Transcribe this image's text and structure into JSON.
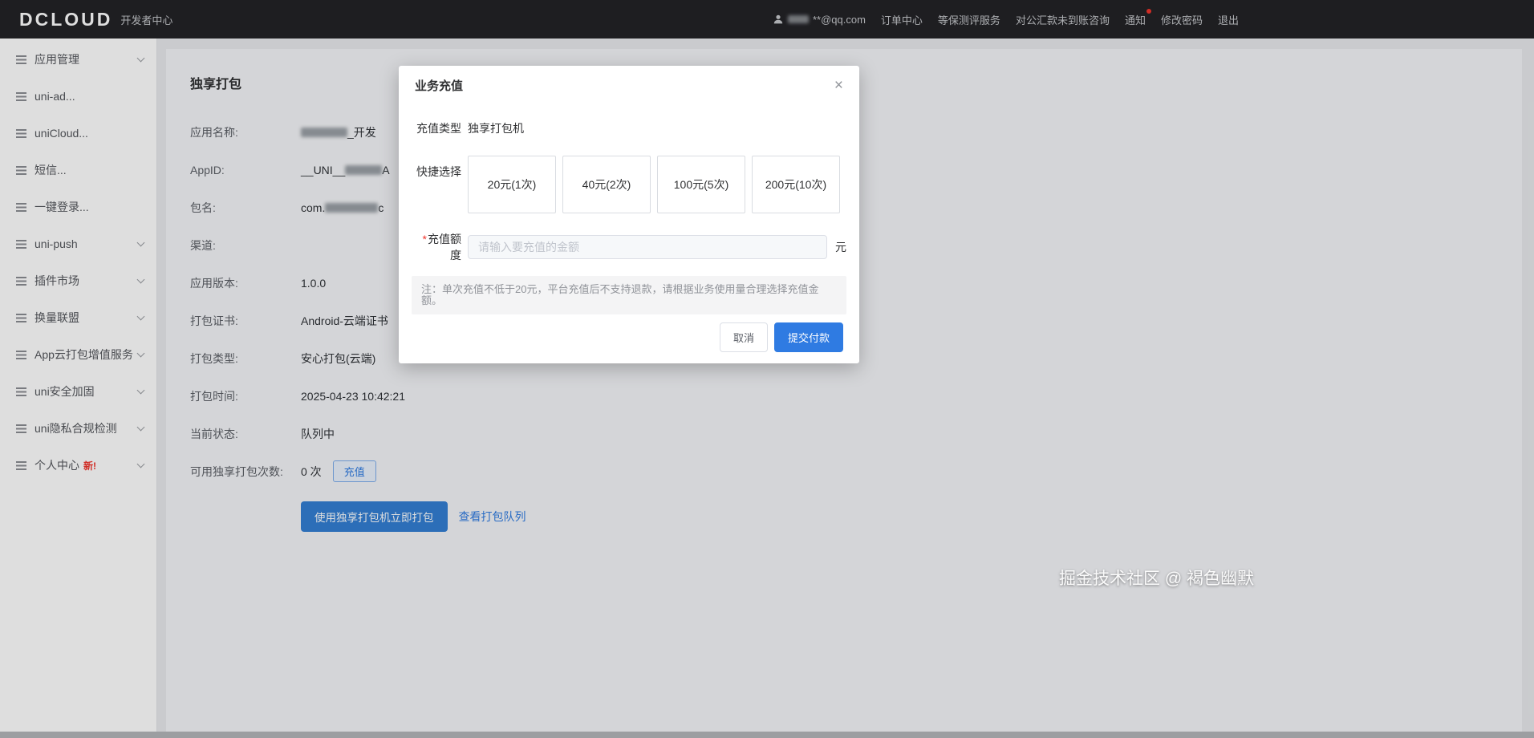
{
  "accent_color": "#2f7be2",
  "header": {
    "logo": "DCLOUD",
    "product": "开发者中心",
    "email_masked": "**@qq.com",
    "nav": [
      "订单中心",
      "等保测评服务",
      "对公汇款未到账咨询",
      "通知",
      "修改密码",
      "退出"
    ]
  },
  "sidebar": {
    "items": [
      {
        "label": "应用管理"
      },
      {
        "label": "uni-ad..."
      },
      {
        "label": "uniCloud..."
      },
      {
        "label": "短信..."
      },
      {
        "label": "一键登录..."
      },
      {
        "label": "uni-push"
      },
      {
        "label": "插件市场"
      },
      {
        "label": "换量联盟"
      },
      {
        "label": "App云打包增值服务"
      },
      {
        "label": "uni安全加固"
      },
      {
        "label": "uni隐私合规检测"
      },
      {
        "label": "个人中心",
        "badge": "新!"
      }
    ]
  },
  "main": {
    "title": "独享打包",
    "rows": [
      {
        "label": "应用名称:",
        "prefix": "",
        "suffix": "_开发"
      },
      {
        "label": "AppID:",
        "prefix": "__UNI__",
        "suffix": "A"
      },
      {
        "label": "包名:",
        "prefix": "com.",
        "suffix": "c"
      },
      {
        "label": "渠道:",
        "value": ""
      },
      {
        "label": "应用版本:",
        "value": "1.0.0"
      },
      {
        "label": "打包证书:",
        "value": "Android-云端证书"
      },
      {
        "label": "打包类型:",
        "value": "安心打包(云端)"
      },
      {
        "label": "打包时间:",
        "value": "2025-04-23 10:42:21"
      },
      {
        "label": "当前状态:",
        "value": "队列中"
      },
      {
        "label": "可用独享打包次数:",
        "value": "0 次",
        "button": "充值"
      }
    ],
    "primary_action": "使用独享打包机立即打包",
    "link_action": "查看打包队列"
  },
  "modal": {
    "title": "业务充值",
    "close": "×",
    "type_label": "充值类型",
    "type_value": "独享打包机",
    "quick_label": "快捷选择",
    "quick_options": [
      "20元(1次)",
      "40元(2次)",
      "100元(5次)",
      "200元(10次)"
    ],
    "amount_required_mark": "*",
    "amount_label": "充值额度",
    "amount_placeholder": "请输入要充值的金额",
    "amount_unit": "元",
    "note": "注：单次充值不低于20元，平台充值后不支持退款，请根据业务使用量合理选择充值金额。",
    "cancel_label": "取消",
    "submit_label": "提交付款"
  },
  "watermark": "掘金技术社区 @ 褐色幽默"
}
